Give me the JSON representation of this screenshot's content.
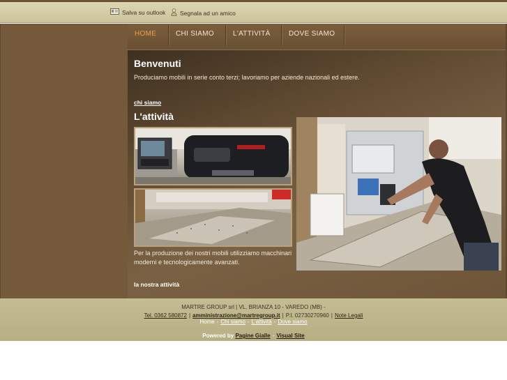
{
  "topbar": {
    "save_outlook": "Salva su outlook",
    "tell_friend": "Segnala ad un amico"
  },
  "nav": {
    "items": [
      {
        "label": "HOME",
        "active": true
      },
      {
        "label": "CHI SIAMO",
        "active": false
      },
      {
        "label": "L'ATTIVITÀ",
        "active": false
      },
      {
        "label": "DOVE SIAMO",
        "active": false
      }
    ]
  },
  "content": {
    "welcome_title": "Benvenuti",
    "welcome_text": "Produciamo mobili in serie conto terzi; lavoriamo per aziende nazionali ed estere.",
    "chi_siamo_link": "chi siamo",
    "activity_title": "L'attività",
    "activity_text": "Per la produzione dei nostri mobili utilizziamo macchinari moderni e tecnologicamente avanzati.",
    "activity_link": "la nostra attività"
  },
  "footer": {
    "company": "MARTRE GROUP srl | VL. BRIANZA 10 - VAREDO (MB) -",
    "tel": "Tel. 0362 580872",
    "email": "amministrazione@martregroup.it",
    "piva": "P.I. 02730270960",
    "legal": "Note Legali",
    "links": [
      "Home",
      "Chi siamo",
      "L'attività",
      "Dove siamo"
    ],
    "powered_by": "Powered by",
    "pagine_gialle": "Pagine Gialle",
    "visual_site": "Visual Site"
  },
  "colors": {
    "nav_active": "#f0a04a",
    "brown_dark": "#74593a",
    "footer_bg": "#c4bc93"
  }
}
